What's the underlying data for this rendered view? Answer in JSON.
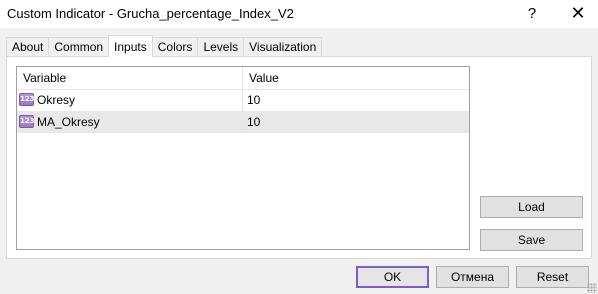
{
  "window": {
    "title": "Custom Indicator - Grucha_percentage_Index_V2",
    "help_glyph": "?",
    "close_glyph": "✕"
  },
  "tabs": [
    {
      "label": "About",
      "active": false
    },
    {
      "label": "Common",
      "active": false
    },
    {
      "label": "Inputs",
      "active": true
    },
    {
      "label": "Colors",
      "active": false
    },
    {
      "label": "Levels",
      "active": false
    },
    {
      "label": "Visualization",
      "active": false
    }
  ],
  "inputs_table": {
    "headers": {
      "variable": "Variable",
      "value": "Value"
    },
    "type_icon": {
      "name": "integer-type-icon",
      "glyph": "123"
    },
    "rows": [
      {
        "variable": "Okresy",
        "value": "10",
        "selected": false
      },
      {
        "variable": "MA_Okresy",
        "value": "10",
        "selected": true
      }
    ]
  },
  "side_buttons": {
    "load": "Load",
    "save": "Save"
  },
  "footer_buttons": {
    "ok": "OK",
    "cancel": "Отмена",
    "reset": "Reset"
  },
  "colors": {
    "ok_focus_border": "#7a5ec9",
    "selected_row": "#e8e8e8",
    "icon_fill": "#9a78c4"
  }
}
